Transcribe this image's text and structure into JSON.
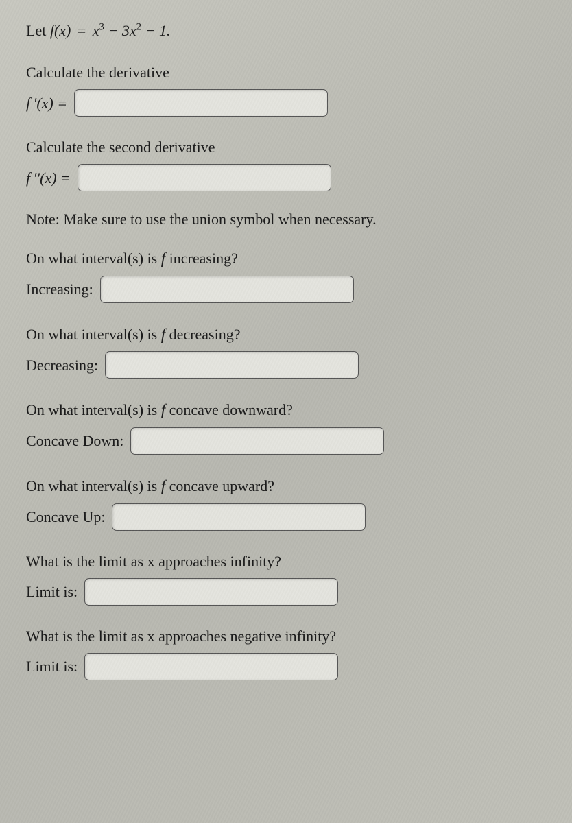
{
  "intro": {
    "let": "Let ",
    "fx": "f(x)",
    "eq": " = ",
    "expr_html": "x³ − 3x² − 1."
  },
  "deriv1": {
    "prompt": "Calculate the derivative",
    "label_html": "f ′(x) ="
  },
  "deriv2": {
    "prompt": "Calculate the second derivative",
    "label_html": "f ′′(x) ="
  },
  "note": "Note: Make sure to use the union symbol when necessary.",
  "increasing": {
    "prompt_pre": "On what interval(s) is ",
    "prompt_post": " increasing?",
    "label": "Increasing:"
  },
  "decreasing": {
    "prompt_pre": "On what interval(s) is ",
    "prompt_post": " decreasing?",
    "label": "Decreasing:"
  },
  "concave_down": {
    "prompt_pre": "On what interval(s) is ",
    "prompt_post": " concave downward?",
    "label": "Concave Down:"
  },
  "concave_up": {
    "prompt_pre": "On what interval(s) is ",
    "prompt_post": " concave upward?",
    "label": "Concave Up:"
  },
  "limit_pos": {
    "prompt": "What is the limit as x approaches infinity?",
    "label": "Limit is:"
  },
  "limit_neg": {
    "prompt": "What is the limit as x approaches negative infinity?",
    "label": "Limit is:"
  },
  "f_symbol": "f"
}
